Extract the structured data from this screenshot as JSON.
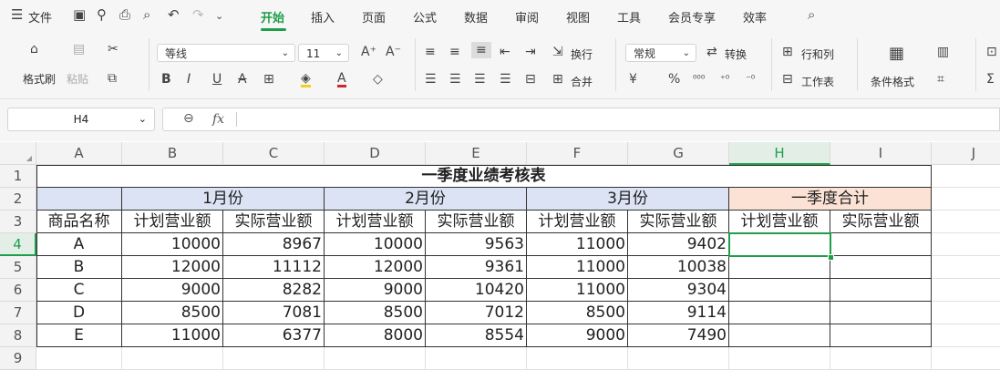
{
  "menu": {
    "file": "文件",
    "tabs": [
      "开始",
      "插入",
      "页面",
      "公式",
      "数据",
      "审阅",
      "视图",
      "工具",
      "会员专享",
      "效率"
    ]
  },
  "ribbon": {
    "format_painter": "格式刷",
    "paste": "粘贴",
    "font_name": "等线",
    "font_size": "11",
    "wrap": "换行",
    "merge": "合并",
    "number_format": "常规",
    "convert": "转换",
    "row_col": "行和列",
    "worksheet": "工作表",
    "cond_format": "条件格式"
  },
  "formula_bar": {
    "cell_ref": "H4",
    "fx": "fx"
  },
  "columns": [
    "A",
    "B",
    "C",
    "D",
    "E",
    "F",
    "G",
    "H",
    "I",
    "J"
  ],
  "rows": [
    "1",
    "2",
    "3",
    "4",
    "5",
    "6",
    "7",
    "8",
    "9"
  ],
  "sheet": {
    "title": "一季度业绩考核表",
    "months": [
      "1月份",
      "2月份",
      "3月份"
    ],
    "total_header": "一季度合计",
    "name_header": "商品名称",
    "plan_label": "计划营业额",
    "actual_label": "实际营业额",
    "records": [
      {
        "name": "A",
        "values": [
          "10000",
          "8967",
          "10000",
          "9563",
          "11000",
          "9402"
        ]
      },
      {
        "name": "B",
        "values": [
          "12000",
          "11112",
          "12000",
          "9361",
          "11000",
          "10038"
        ]
      },
      {
        "name": "C",
        "values": [
          "9000",
          "8282",
          "9000",
          "10420",
          "11000",
          "9304"
        ]
      },
      {
        "name": "D",
        "values": [
          "8500",
          "7081",
          "8500",
          "7012",
          "8500",
          "9114"
        ]
      },
      {
        "name": "E",
        "values": [
          "11000",
          "6377",
          "8000",
          "8554",
          "9000",
          "7490"
        ]
      }
    ]
  },
  "colors": {
    "accent": "#1e9e4a",
    "month_fill": "#dbe3f4",
    "total_fill": "#fbe2d5"
  }
}
